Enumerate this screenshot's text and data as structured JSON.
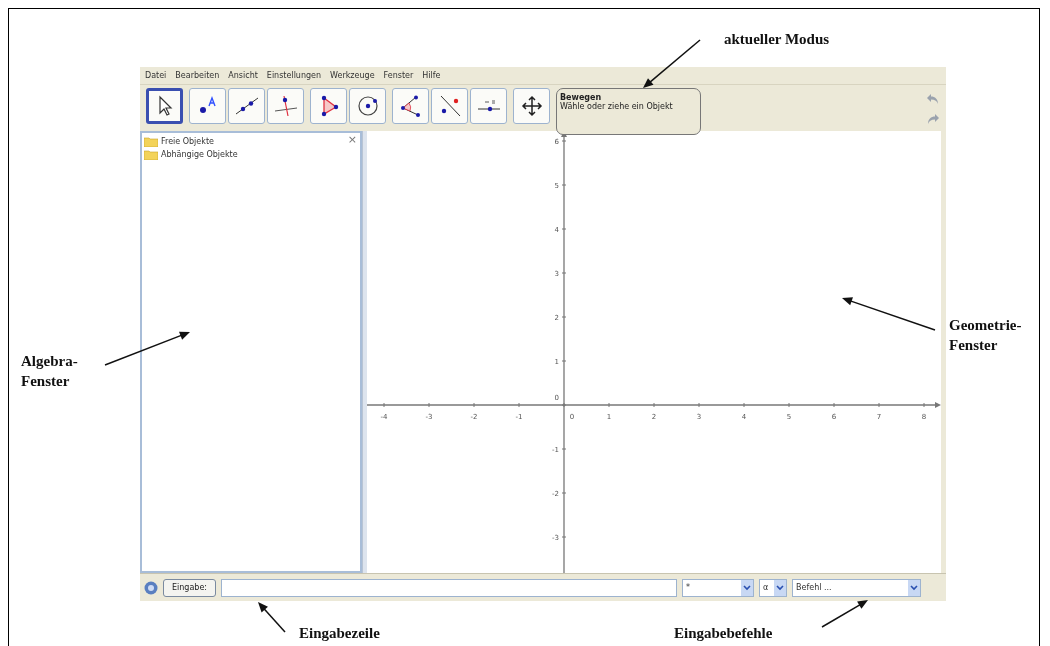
{
  "menu": [
    "Datei",
    "Bearbeiten",
    "Ansicht",
    "Einstellungen",
    "Werkzeuge",
    "Fenster",
    "Hilfe"
  ],
  "toolbar": {
    "groups": [
      [
        {
          "kind": "move",
          "selected": true
        }
      ],
      [
        {
          "kind": "point",
          "selected": false
        },
        {
          "kind": "line",
          "selected": false
        },
        {
          "kind": "perpendicular",
          "selected": false
        }
      ],
      [
        {
          "kind": "polygon",
          "selected": false
        },
        {
          "kind": "circle",
          "selected": false
        }
      ],
      [
        {
          "kind": "angle",
          "selected": false
        },
        {
          "kind": "reflect",
          "selected": false
        },
        {
          "kind": "slider",
          "selected": false
        }
      ],
      [
        {
          "kind": "pan",
          "selected": false
        }
      ]
    ],
    "mode": {
      "name": "Bewegen",
      "help": "Wähle oder ziehe ein Objekt"
    }
  },
  "algebra": {
    "folders": [
      "Freie Objekte",
      "Abhängige Objekte"
    ],
    "close": "×"
  },
  "graphics": {
    "x_axis": {
      "negative": [
        "-4",
        "-3",
        "-2",
        "-1"
      ],
      "origin": "0",
      "positive": [
        "1",
        "2",
        "3",
        "4",
        "5",
        "6",
        "7",
        "8"
      ]
    },
    "y_axis": {
      "positive": [
        "6",
        "5",
        "4",
        "3",
        "2",
        "1"
      ],
      "origin": "0",
      "negative": [
        "-1",
        "-2",
        "-3"
      ]
    }
  },
  "input_bar": {
    "button": "Eingabe:",
    "symbol": "*",
    "greek": "α",
    "command": "Befehl ..."
  },
  "annotations": [
    {
      "lines": [
        "aktueller Modus"
      ]
    },
    {
      "lines": [
        "Algebra-",
        "Fenster"
      ]
    },
    {
      "lines": [
        "Geometrie-",
        "Fenster"
      ]
    },
    {
      "lines": [
        "Eingabezeile"
      ]
    },
    {
      "lines": [
        "Eingabebefehle"
      ]
    }
  ]
}
